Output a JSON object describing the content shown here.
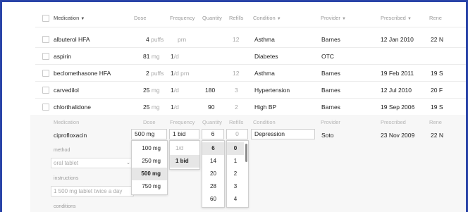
{
  "header": {
    "medication": "Medication",
    "medication_arrow": "▼",
    "dose": "Dose",
    "frequency": "Frequency",
    "quantity": "Quantity",
    "refills": "Refills",
    "condition": "Condition",
    "condition_arrow": "▼",
    "provider": "Provider",
    "provider_arrow": "▼",
    "prescribed": "Prescribed",
    "prescribed_arrow": "▼",
    "renewed": "Rene"
  },
  "rows": [
    {
      "medication": "albuterol HFA",
      "dose_num": "4",
      "dose_unit": "puffs",
      "freq_num": "",
      "freq_unit": "prn",
      "quantity": "",
      "refills": "12",
      "condition": "Asthma",
      "provider": "Barnes",
      "prescribed": "12 Jan 2010",
      "renewed": "22 N"
    },
    {
      "medication": "aspirin",
      "dose_num": "81",
      "dose_unit": "mg",
      "freq_num": "1",
      "freq_unit": "/d",
      "quantity": "",
      "refills": "",
      "condition": "Diabetes",
      "provider": "OTC",
      "prescribed": "",
      "renewed": ""
    },
    {
      "medication": "beclomethasone HFA",
      "dose_num": "2",
      "dose_unit": "puffs",
      "freq_num": "1",
      "freq_unit": "/d prn",
      "quantity": "",
      "refills": "12",
      "condition": "Asthma",
      "provider": "Barnes",
      "prescribed": "19 Feb 2011",
      "renewed": "19 S"
    },
    {
      "medication": "carvedilol",
      "dose_num": "25",
      "dose_unit": "mg",
      "freq_num": "1",
      "freq_unit": "/d",
      "quantity": "180",
      "refills": "3",
      "condition": "Hypertension",
      "provider": "Barnes",
      "prescribed": "12 Jul 2010",
      "renewed": "20 F"
    },
    {
      "medication": "chlorthalidone",
      "dose_num": "25",
      "dose_unit": "mg",
      "freq_num": "1",
      "freq_unit": "/d",
      "quantity": "90",
      "refills": "2",
      "condition": "High BP",
      "provider": "Barnes",
      "prescribed": "19 Sep 2006",
      "renewed": "19 S"
    }
  ],
  "edit_header": {
    "medication": "Medication",
    "dose": "Dose",
    "frequency": "Frequency",
    "quantity": "Quantity",
    "refills": "Refills",
    "condition": "Condition",
    "provider": "Provider",
    "prescribed": "Prescribed",
    "renewed": "Rene"
  },
  "edit_row": {
    "medication": "ciprofloxacin",
    "dose": "500 mg",
    "freq": "1 bid",
    "quantity": "6",
    "refills": "0",
    "condition": "Depression",
    "provider": "Soto",
    "prescribed": "23 Nov 2009",
    "renewed": "22 N"
  },
  "dose_options": [
    "100 mg",
    "250 mg",
    "500 mg",
    "750 mg"
  ],
  "dose_selected": "500 mg",
  "freq_options": [
    "1/d",
    "1 bid"
  ],
  "freq_selected": "1 bid",
  "quantity_options": [
    "6",
    "14",
    "20",
    "28",
    "60"
  ],
  "quantity_selected": "6",
  "refill_options": [
    "0",
    "1",
    "2",
    "3",
    "4"
  ],
  "refill_selected": "0",
  "method": {
    "label": "method",
    "value": "oral tablet"
  },
  "instructions": {
    "label": "instructions",
    "value": "1 500 mg tablet twice a day"
  },
  "conditions": {
    "label": "conditions"
  },
  "colors": {
    "frame": "#2a44a8",
    "selected": "#e6e6e6",
    "edit_bg": "#f7f7f7"
  }
}
